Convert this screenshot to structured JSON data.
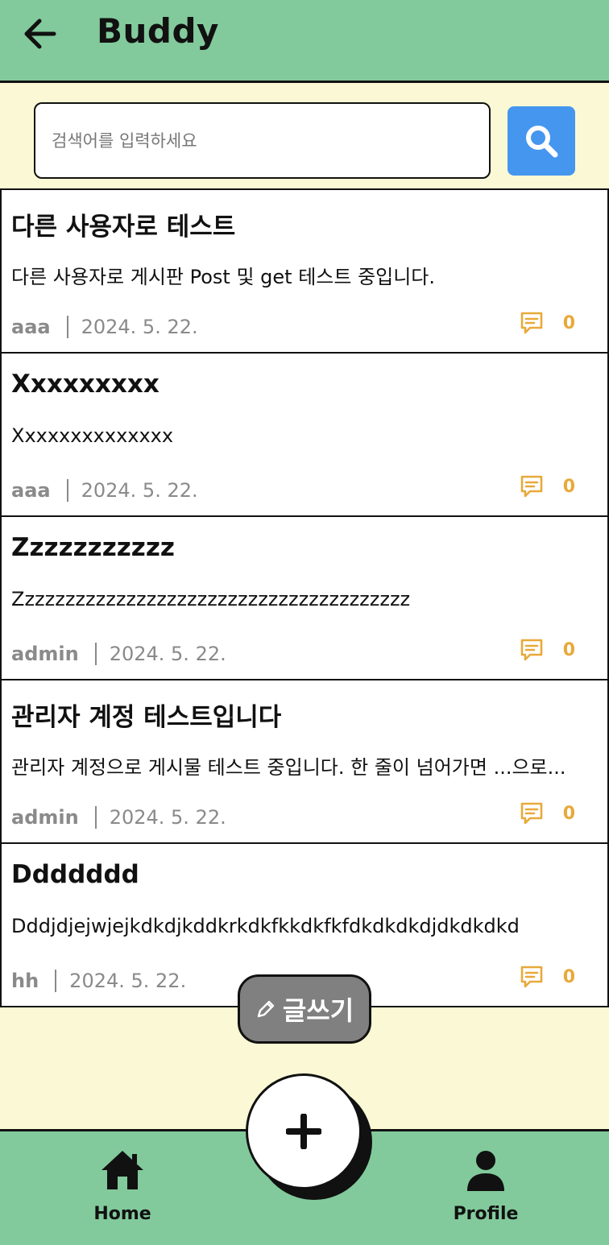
{
  "app_bar": {
    "title": "Buddy",
    "back_icon": "arrow-left-icon"
  },
  "search": {
    "placeholder": "검색어를 입력하세요",
    "value": "",
    "button_icon": "search-icon"
  },
  "posts": [
    {
      "title": "다른 사용자로 테스트",
      "body": "다른 사용자로 게시판 Post 및 get 테스트 중입니다.",
      "author": "aaa",
      "date": "2024. 5. 22.",
      "comments": "0"
    },
    {
      "title": "Xxxxxxxxx",
      "body": "Xxxxxxxxxxxxxx",
      "author": "aaa",
      "date": "2024. 5. 22.",
      "comments": "0"
    },
    {
      "title": "Zzzzzzzzzzz",
      "body": "Zzzzzzzzzzzzzzzzzzzzzzzzzzzzzzzzzzzzzzz",
      "author": "admin",
      "date": "2024. 5. 22.",
      "comments": "0"
    },
    {
      "title": "관리자 계정 테스트입니다",
      "body": "관리자 계정으로 게시물 테스트 중입니다. 한 줄이 넘어가면 ...으로...",
      "author": "admin",
      "date": "2024. 5. 22.",
      "comments": "0"
    },
    {
      "title": "Ddddddd",
      "body": "Dddjdjejwjejkdkdjkddkrkdkfkkdkfkfdkdkdkdjdkdkdkd",
      "author": "hh",
      "date": "2024. 5. 22.",
      "comments": "0"
    }
  ],
  "write_button": {
    "label": "글쓰기",
    "icon": "pencil-icon"
  },
  "fab": {
    "icon": "plus-icon"
  },
  "bottom_nav": {
    "home": {
      "label": "Home",
      "icon": "home-icon"
    },
    "profile": {
      "label": "Profile",
      "icon": "person-icon"
    }
  },
  "colors": {
    "app_bar_bg": "#82ca9c",
    "page_bg": "#fbf9d5",
    "search_button": "#4596ef",
    "comment_accent": "#e8a93a",
    "meta_text": "#8a8a8a",
    "write_button_bg": "#808080"
  }
}
